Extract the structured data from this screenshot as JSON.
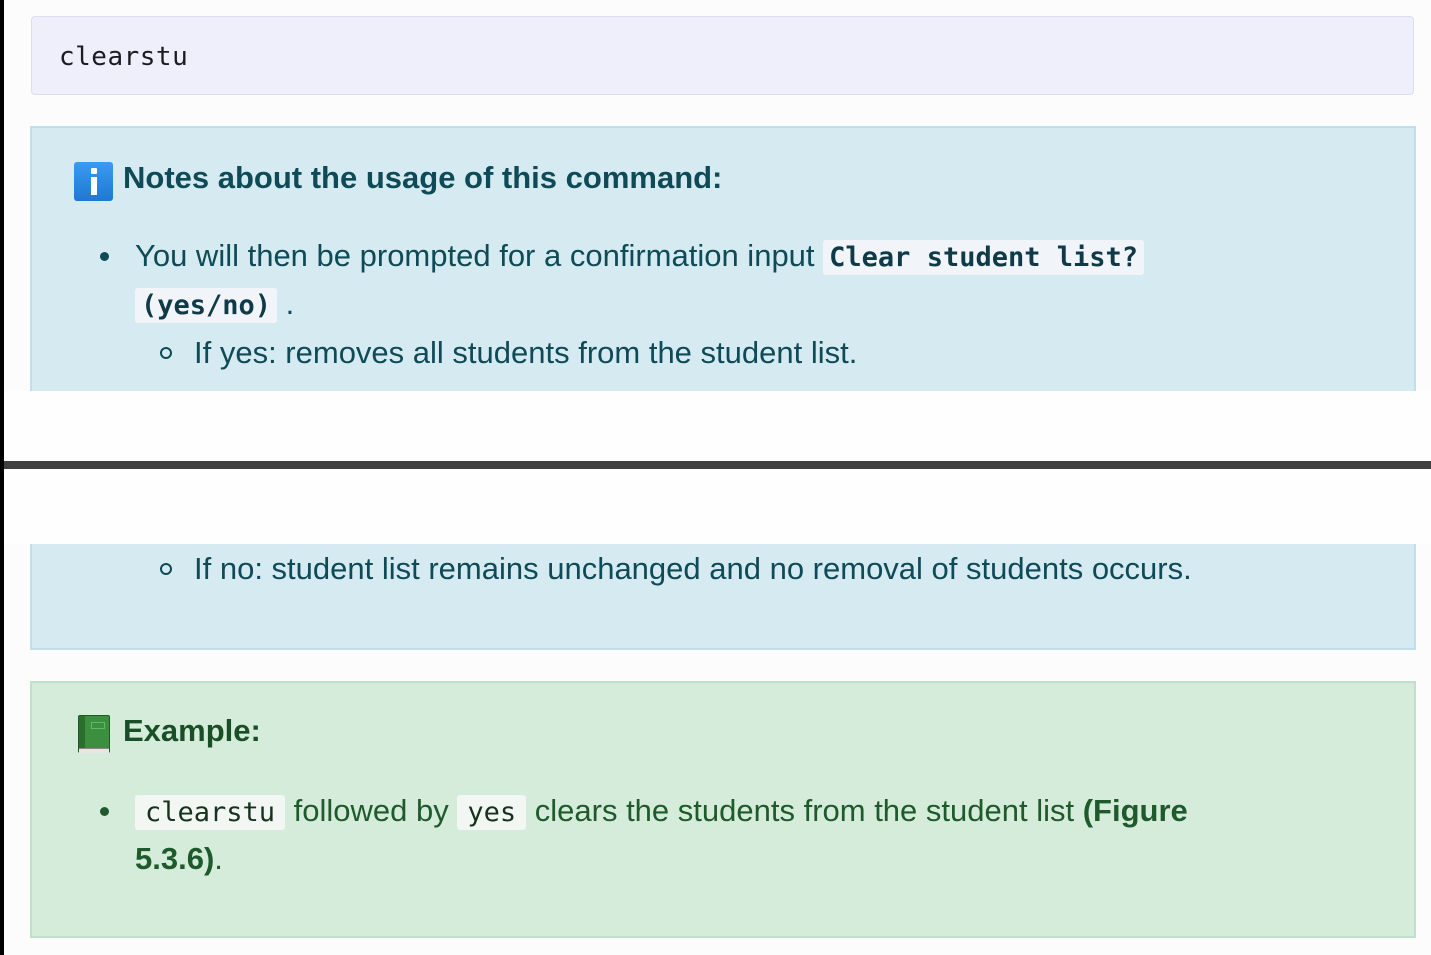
{
  "code_block": {
    "text": "clearstu"
  },
  "notes": {
    "heading": "Notes about the usage of this command:",
    "bullet1_prefix": "You will then be prompted for a confirmation input ",
    "bullet1_code_part1": "Clear student list?",
    "bullet1_code_part2": "(yes/no)",
    "bullet1_suffix": ".",
    "sub_yes": "If yes: removes all students from the student list.",
    "sub_no": "If no: student list remains unchanged and no removal of students occurs."
  },
  "example": {
    "heading": "Example:",
    "code1": "clearstu",
    "text1": " followed by ",
    "code2": "yes",
    "text2": " clears the students from the student list ",
    "figure_ref_line1": "(Figure",
    "figure_ref_line2": "5.3.6)",
    "suffix": "."
  },
  "colors": {
    "info_bg": "#d5ebf1",
    "success_bg": "#d5ecdb",
    "code_bg": "#efeefb",
    "separator": "#404040"
  },
  "icons": {
    "notes_icon": "information-icon",
    "example_icon": "green-book-icon"
  }
}
